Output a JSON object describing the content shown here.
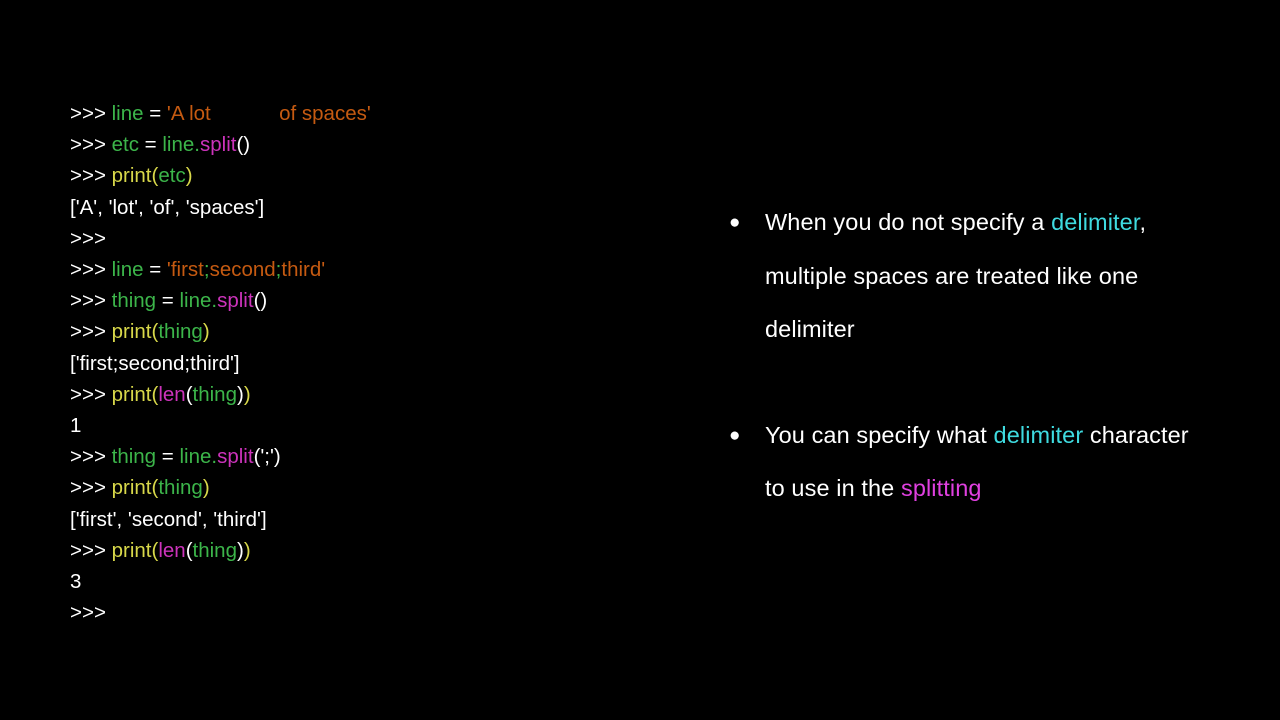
{
  "slide": {
    "background_color": "#000000",
    "colors": {
      "prompt": "#ffffff",
      "variable": "#3cb54a",
      "string": "#c55a11",
      "function": "#d8d84a",
      "method": "#cc33bb",
      "builtin": "#cc33bb",
      "output": "#ffffff",
      "bullet_text": "#ffffff",
      "highlight_cyan": "#3fdbe0",
      "highlight_pink": "#e040e0"
    }
  },
  "console": {
    "name": "python-repl-transcript",
    "lines": [
      {
        "id": "line-1",
        "plain": ">>> line = 'A lot            of spaces'",
        "tokens": [
          {
            "text": ">>> ",
            "type": "prompt"
          },
          {
            "text": "line",
            "type": "name"
          },
          {
            "text": " = ",
            "type": "op"
          },
          {
            "text": "'A lot",
            "type": "string"
          },
          {
            "text": "            ",
            "type": "string"
          },
          {
            "text": "of spaces'",
            "type": "string"
          }
        ]
      },
      {
        "id": "line-2",
        "plain": ">>> etc = line.split()",
        "tokens": [
          {
            "text": ">>> ",
            "type": "prompt"
          },
          {
            "text": "etc",
            "type": "name"
          },
          {
            "text": " = ",
            "type": "op"
          },
          {
            "text": "line",
            "type": "name"
          },
          {
            "text": ".",
            "type": "dot"
          },
          {
            "text": "split",
            "type": "method"
          },
          {
            "text": "()",
            "type": "paren-w"
          }
        ]
      },
      {
        "id": "line-3",
        "plain": ">>> print(etc)",
        "tokens": [
          {
            "text": ">>> ",
            "type": "prompt"
          },
          {
            "text": "print",
            "type": "func"
          },
          {
            "text": "(",
            "type": "paren-y"
          },
          {
            "text": "etc",
            "type": "name"
          },
          {
            "text": ")",
            "type": "paren-y"
          }
        ]
      },
      {
        "id": "line-4",
        "plain": "['A', 'lot', 'of', 'spaces']",
        "tokens": [
          {
            "text": "['A', 'lot', 'of', 'spaces']",
            "type": "plain"
          }
        ]
      },
      {
        "id": "line-5",
        "plain": ">>>",
        "tokens": [
          {
            "text": ">>>",
            "type": "prompt"
          }
        ]
      },
      {
        "id": "line-6",
        "plain": ">>> line = 'first;second;third'",
        "tokens": [
          {
            "text": ">>> ",
            "type": "prompt"
          },
          {
            "text": "line",
            "type": "name"
          },
          {
            "text": " = ",
            "type": "op"
          },
          {
            "text": "'first",
            "type": "string"
          },
          {
            "text": ";",
            "type": "str-sep"
          },
          {
            "text": "second",
            "type": "string"
          },
          {
            "text": ";",
            "type": "str-sep"
          },
          {
            "text": "third'",
            "type": "string"
          }
        ]
      },
      {
        "id": "line-7",
        "plain": ">>> thing = line.split()",
        "tokens": [
          {
            "text": ">>> ",
            "type": "prompt"
          },
          {
            "text": "thing",
            "type": "name"
          },
          {
            "text": " = ",
            "type": "op"
          },
          {
            "text": "line",
            "type": "name"
          },
          {
            "text": ".",
            "type": "dot"
          },
          {
            "text": "split",
            "type": "method"
          },
          {
            "text": "()",
            "type": "paren-w"
          }
        ]
      },
      {
        "id": "line-8",
        "plain": ">>> print(thing)",
        "tokens": [
          {
            "text": ">>> ",
            "type": "prompt"
          },
          {
            "text": "print",
            "type": "func"
          },
          {
            "text": "(",
            "type": "paren-y"
          },
          {
            "text": "thing",
            "type": "name"
          },
          {
            "text": ")",
            "type": "paren-y"
          }
        ]
      },
      {
        "id": "line-9",
        "plain": "['first;second;third']",
        "tokens": [
          {
            "text": "['first;second;third']",
            "type": "plain"
          }
        ]
      },
      {
        "id": "line-10",
        "plain": ">>> print(len(thing))",
        "tokens": [
          {
            "text": ">>> ",
            "type": "prompt"
          },
          {
            "text": "print",
            "type": "func"
          },
          {
            "text": "(",
            "type": "paren-y"
          },
          {
            "text": "len",
            "type": "builtin"
          },
          {
            "text": "(",
            "type": "paren-w"
          },
          {
            "text": "thing",
            "type": "name"
          },
          {
            "text": ")",
            "type": "paren-w"
          },
          {
            "text": ")",
            "type": "paren-y"
          }
        ]
      },
      {
        "id": "line-11",
        "plain": "1",
        "tokens": [
          {
            "text": "1",
            "type": "plain"
          }
        ]
      },
      {
        "id": "line-12",
        "plain": ">>> thing = line.split(';')",
        "tokens": [
          {
            "text": ">>> ",
            "type": "prompt"
          },
          {
            "text": "thing",
            "type": "name"
          },
          {
            "text": " = ",
            "type": "op"
          },
          {
            "text": "line",
            "type": "name"
          },
          {
            "text": ".",
            "type": "dot"
          },
          {
            "text": "split",
            "type": "method"
          },
          {
            "text": "(",
            "type": "paren-w"
          },
          {
            "text": "';'",
            "type": "plain"
          },
          {
            "text": ")",
            "type": "paren-w"
          }
        ]
      },
      {
        "id": "line-13",
        "plain": ">>> print(thing)",
        "tokens": [
          {
            "text": ">>> ",
            "type": "prompt"
          },
          {
            "text": "print",
            "type": "func"
          },
          {
            "text": "(",
            "type": "paren-y"
          },
          {
            "text": "thing",
            "type": "name"
          },
          {
            "text": ")",
            "type": "paren-y"
          }
        ]
      },
      {
        "id": "line-14",
        "plain": "['first', 'second', 'third']",
        "tokens": [
          {
            "text": "['first', 'second', 'third']",
            "type": "plain"
          }
        ]
      },
      {
        "id": "line-15",
        "plain": ">>> print(len(thing))",
        "tokens": [
          {
            "text": ">>> ",
            "type": "prompt"
          },
          {
            "text": "print",
            "type": "func"
          },
          {
            "text": "(",
            "type": "paren-y"
          },
          {
            "text": "len",
            "type": "builtin"
          },
          {
            "text": "(",
            "type": "paren-w"
          },
          {
            "text": "thing",
            "type": "name"
          },
          {
            "text": ")",
            "type": "paren-w"
          },
          {
            "text": ")",
            "type": "paren-y"
          }
        ]
      },
      {
        "id": "line-16",
        "plain": "3",
        "tokens": [
          {
            "text": "3",
            "type": "plain"
          }
        ]
      },
      {
        "id": "line-17",
        "plain": ">>>",
        "tokens": [
          {
            "text": ">>>",
            "type": "prompt"
          }
        ]
      }
    ]
  },
  "bullets": {
    "marker": "●",
    "items": [
      {
        "id": "bullet-1",
        "plain": "When you do not specify a delimiter, multiple spaces are treated like one delimiter",
        "runs": [
          {
            "text": "When you do not specify a ",
            "style": "normal"
          },
          {
            "text": "delimiter",
            "style": "cyan"
          },
          {
            "text": ", multiple spaces are treated like one delimiter",
            "style": "normal"
          }
        ]
      },
      {
        "id": "bullet-2",
        "plain": "You can specify what delimiter character to use in the splitting",
        "runs": [
          {
            "text": "You can specify what ",
            "style": "normal"
          },
          {
            "text": "delimiter",
            "style": "cyan"
          },
          {
            "text": " character to use in the ",
            "style": "normal"
          },
          {
            "text": "splitting",
            "style": "pink"
          }
        ]
      }
    ]
  }
}
